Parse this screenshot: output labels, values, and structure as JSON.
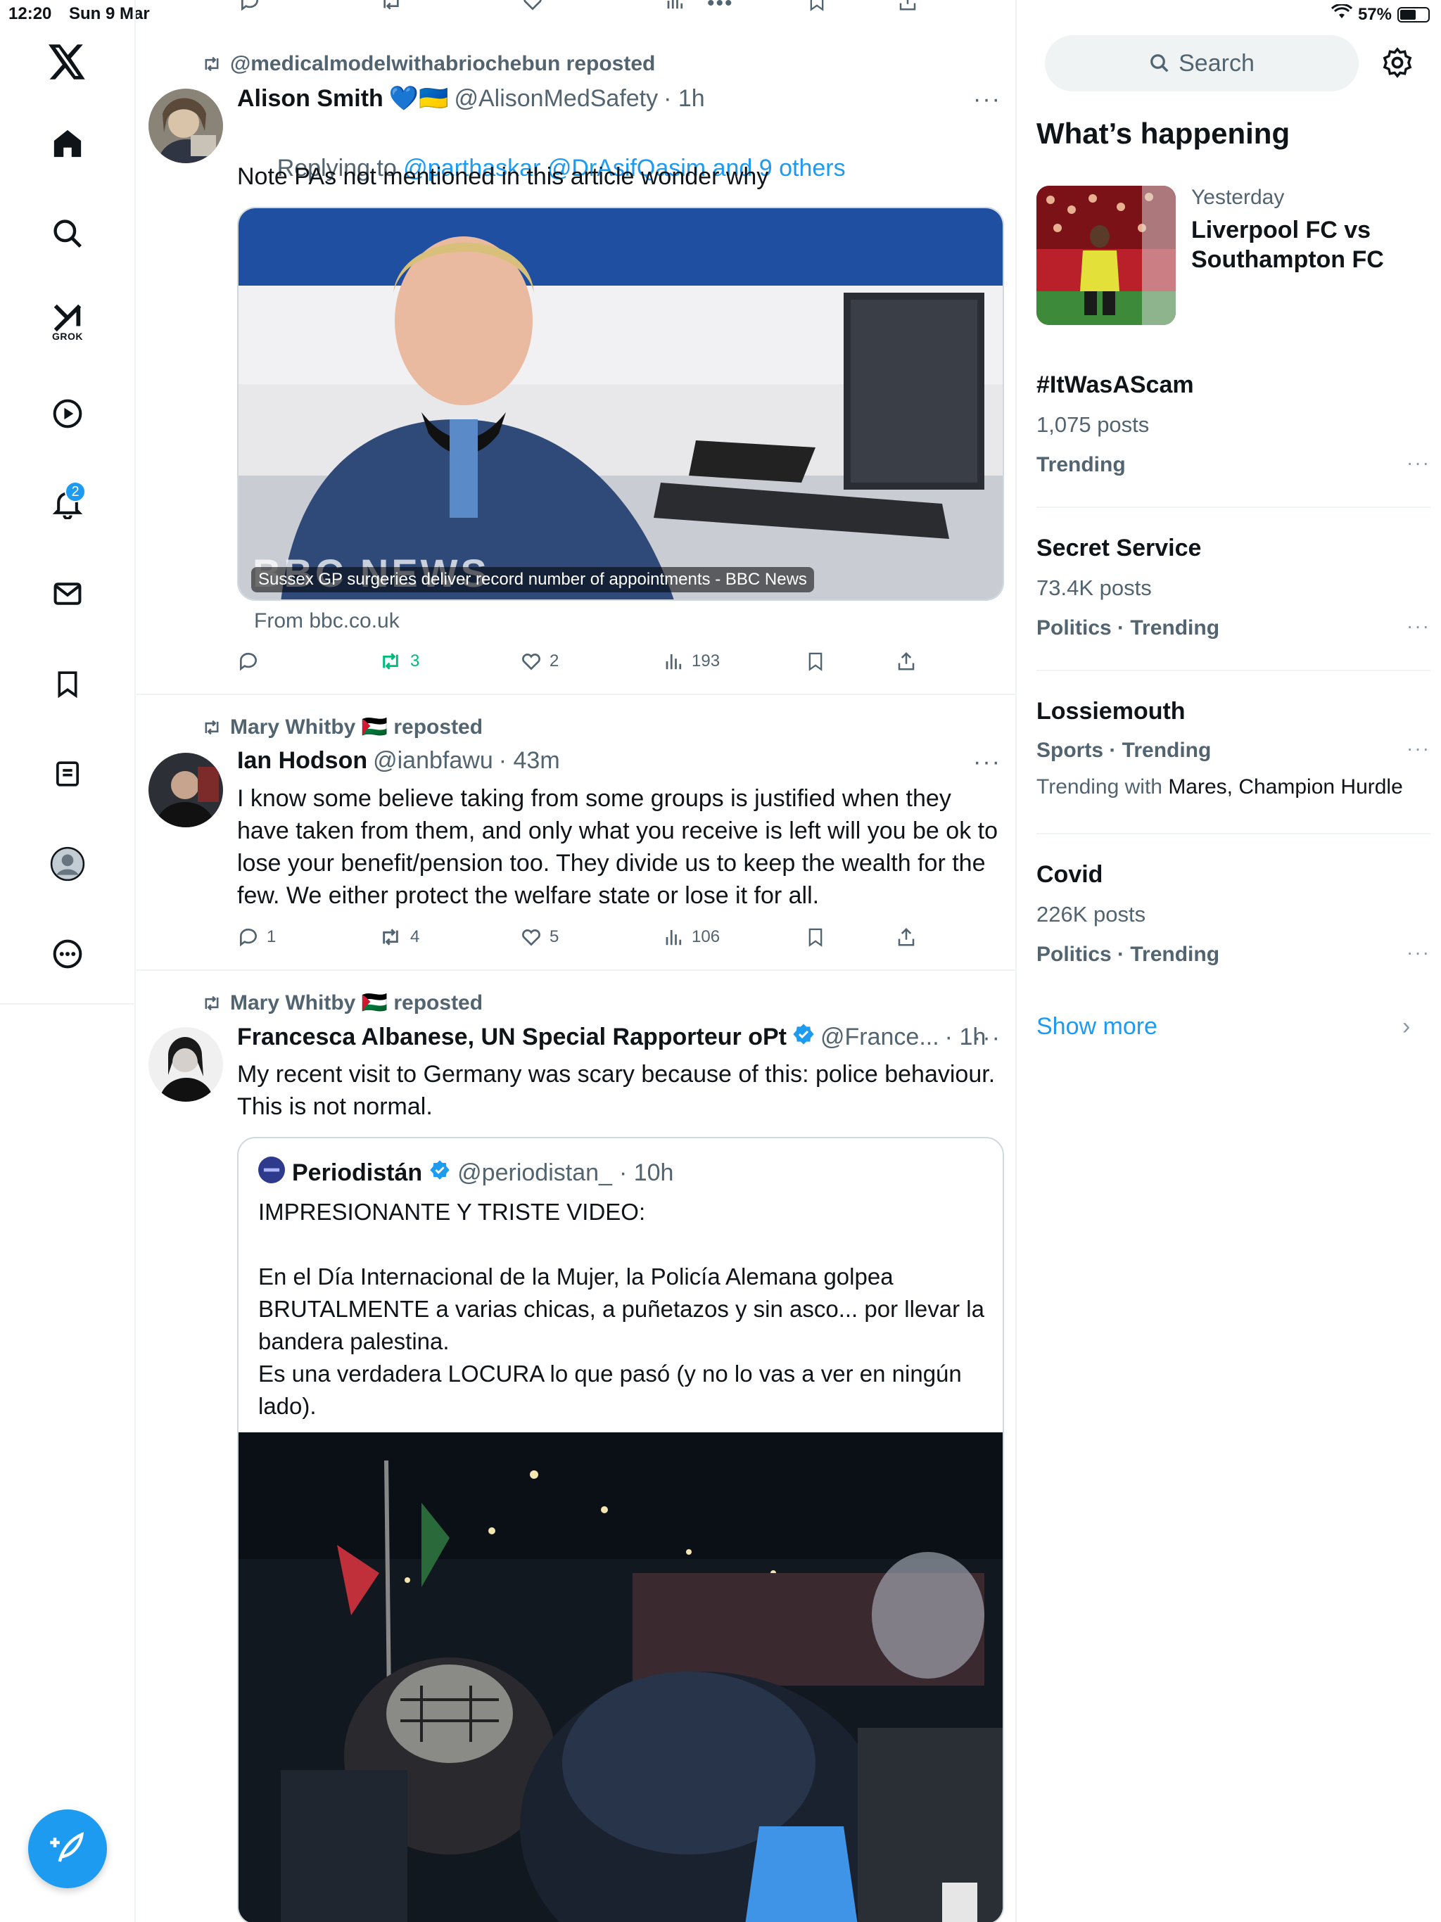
{
  "status_bar": {
    "time": "12:20",
    "date": "Sun 9 Mar",
    "battery_percent": "57%",
    "battery_level": 0.57
  },
  "nav": {
    "grok_label": "GROK",
    "notifications_badge": "2"
  },
  "timeline": {
    "tweets": [
      {
        "repost_by": "@medicalmodelwithabriochebun reposted",
        "name": "Alison Smith",
        "name_emoji": "💙🇺🇦",
        "handle": "@AlisonMedSafety",
        "time": "· 1h",
        "reply_prefix": "Replying to ",
        "reply_targets": "@parthaskar @DrAsifQasim and 9 others",
        "text": "Note PAs not mentioned in this article wonder why",
        "card_caption": "Sussex GP surgeries deliver record number of appointments - BBC News",
        "card_watermark": "BBC NEWS",
        "card_source": "From bbc.co.uk",
        "replies": "",
        "reposts": "3",
        "likes": "2",
        "views": "193"
      },
      {
        "repost_by": "Mary Whitby 🇵🇸 reposted",
        "name": "Ian Hodson",
        "handle": "@ianbfawu",
        "time": "· 43m",
        "text": "I know some believe taking from some groups is justified when they have taken from them, and only what you receive is left will you be ok to lose your benefit/pension too. They divide us to keep the wealth for the few. We either protect the welfare state or lose it for all.",
        "replies": "1",
        "reposts": "4",
        "likes": "5",
        "views": "106"
      },
      {
        "repost_by": "Mary Whitby 🇵🇸 reposted",
        "name": "Francesca Albanese, UN Special Rapporteur oPt",
        "handle": "@France...",
        "time": "· 1h",
        "text": "My recent visit to Germany was scary because of this: police behaviour. This is not normal.",
        "quote": {
          "name": "Periodistán",
          "handle": "@periodistan_",
          "time": "· 10h",
          "text": "IMPRESIONANTE Y TRISTE VIDEO:\n\nEn el Día Internacional de la Mujer, la Policía Alemana golpea BRUTALMENTE a varias chicas, a puñetazos y sin asco... por llevar la bandera palestina.\nEs una verdadera LOCURA lo que pasó (y no lo vas a ver en ningún lado)."
        }
      }
    ]
  },
  "sidebar": {
    "search_placeholder": "Search",
    "whats_happening": "What’s happening",
    "top_trend": {
      "meta": "Yesterday",
      "title": "Liverpool FC vs Southampton FC"
    },
    "trends": [
      {
        "title": "#ItWasAScam",
        "line": "1,075 posts",
        "category": "Trending"
      },
      {
        "title": "Secret Service",
        "line": "73.4K posts",
        "category": "Politics · Trending"
      },
      {
        "title": "Lossiemouth",
        "category": "Sports · Trending",
        "with_prefix": "Trending with ",
        "with_names": "Mares, Champion Hurdle"
      },
      {
        "title": "Covid",
        "line": "226K posts",
        "category": "Politics · Trending"
      }
    ],
    "show_more": "Show more"
  },
  "colors": {
    "accent": "#1d9bf0",
    "text_primary": "#0f1419",
    "text_secondary": "#536471",
    "repost_active": "#00ba7c"
  }
}
